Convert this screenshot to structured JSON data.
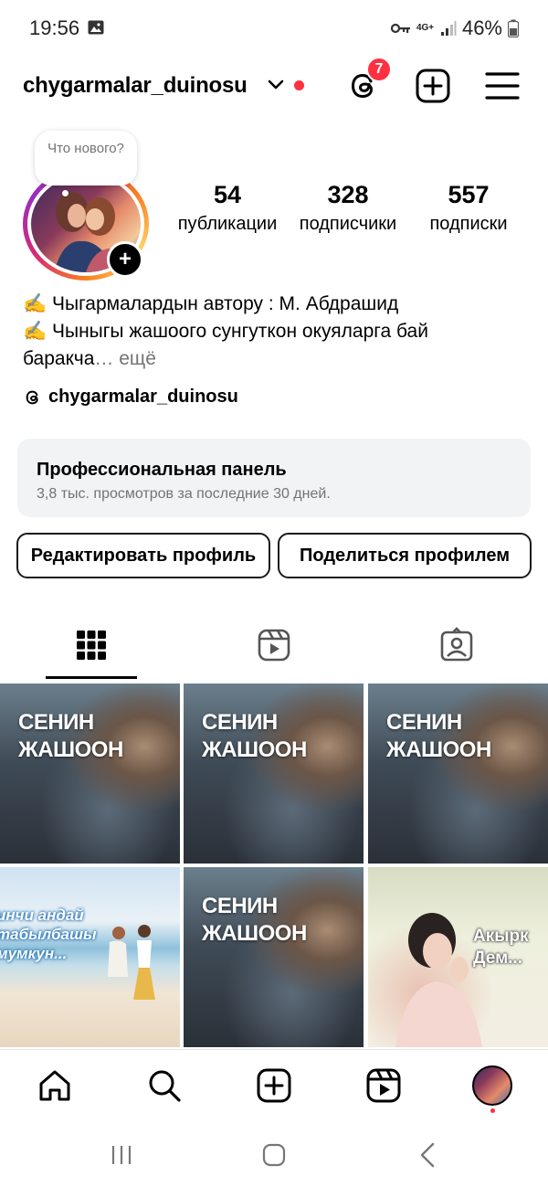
{
  "status_bar": {
    "time": "19:56",
    "network": "4G+",
    "battery": "46%"
  },
  "header": {
    "username": "chygarmalar_duinosu",
    "threads_badge": "7"
  },
  "profile": {
    "note": "Что нового?",
    "stats": [
      {
        "value": "54",
        "label": "публикации"
      },
      {
        "value": "328",
        "label": "подписчики"
      },
      {
        "value": "557",
        "label": "подписки"
      }
    ],
    "bio_line1": "✍️ Чыгармалардын автору : М. Абдрашид",
    "bio_line2": "✍️ Чыныгы жашоого сунгуткон окуяларга бай",
    "bio_line3": "баракча",
    "bio_more": "… ещё",
    "threads_handle": "chygarmalar_duinosu"
  },
  "pro_panel": {
    "title": "Профессиональная панель",
    "subtitle": "3,8 тыс. просмотров за последние 30 дней."
  },
  "buttons": {
    "edit": "Редактировать профиль",
    "share": "Поделиться профилем"
  },
  "posts": {
    "rain_text_line1": "СЕНИН",
    "rain_text_line2": "ЖАШООН",
    "beach_text_line1": "инчи андай",
    "beach_text_line2": "табылбашы",
    "beach_text_line3": "мумкун...",
    "pray_text_line1": "Акырк",
    "pray_text_line2": "Дем..."
  },
  "colors": {
    "accent_red": "#ff3040",
    "panel_bg": "#f2f3f5",
    "muted_text": "#737373"
  }
}
